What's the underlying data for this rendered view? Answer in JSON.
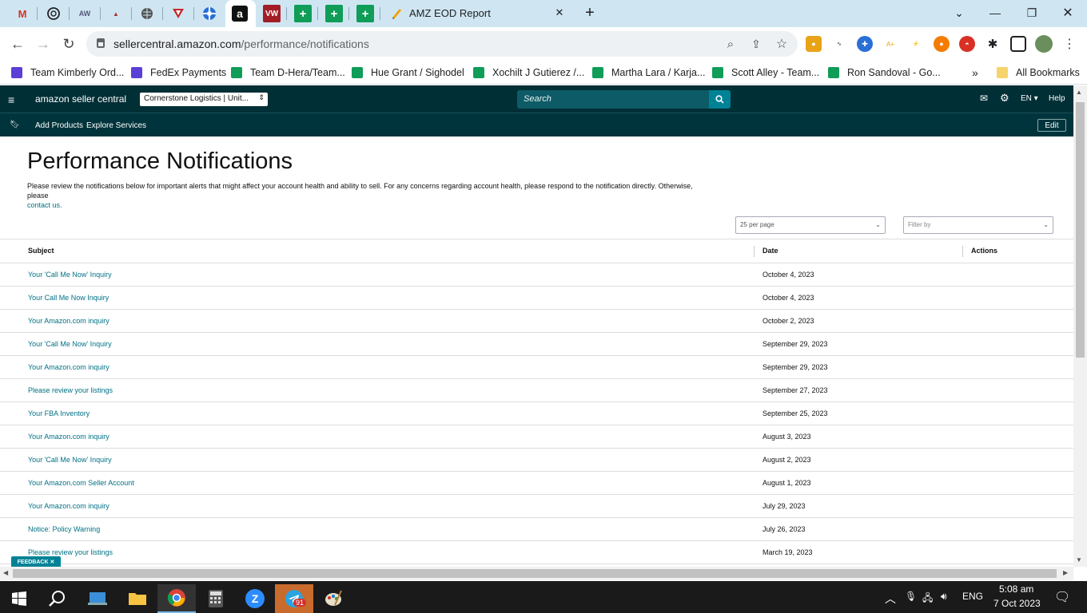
{
  "browser": {
    "active_tab_title": "AMZ EOD Report",
    "url_host": "sellercentral.amazon.com",
    "url_path": "/performance/notifications",
    "bookmarks": [
      {
        "label": "Team Kimberly Ord...",
        "color": "#5b3fd6"
      },
      {
        "label": "FedEx Payments",
        "color": "#5b3fd6"
      },
      {
        "label": "Team D-Hera/Team...",
        "color": "#0f9d58"
      },
      {
        "label": "Hue Grant / Sighodel",
        "color": "#0f9d58"
      },
      {
        "label": "Xochilt J Gutierez /...",
        "color": "#0f9d58"
      },
      {
        "label": "Martha Lara / Karja...",
        "color": "#0f9d58"
      },
      {
        "label": "Scott Alley - Team...",
        "color": "#0f9d58"
      },
      {
        "label": "Ron Sandoval - Go...",
        "color": "#0f9d58"
      }
    ],
    "overflow_label": "»",
    "all_bookmarks_label": "All Bookmarks"
  },
  "seller_central": {
    "logo_text": "amazon seller central",
    "account_selector": "Cornerstone Logistics | Unit...",
    "search_placeholder": "Search",
    "language": "EN",
    "help_label": "Help",
    "nav_links": [
      "Add Products",
      "Explore Services"
    ],
    "edit_label": "Edit"
  },
  "page": {
    "title": "Performance Notifications",
    "description": "Please review the notifications below for important alerts that might affect your account health and ability to sell. For any concerns regarding account health, please respond to the notification directly. Otherwise, please",
    "contact_link": "contact us.",
    "per_page": "25 per page",
    "filter_placeholder": "Filter by"
  },
  "table": {
    "columns": [
      "Subject",
      "Date",
      "Actions"
    ],
    "rows": [
      {
        "subject": "Your 'Call Me Now' Inquiry",
        "date": "October 4, 2023"
      },
      {
        "subject": "Your Call Me Now Inquiry",
        "date": "October 4, 2023"
      },
      {
        "subject": "Your Amazon.com inquiry",
        "date": "October 2, 2023"
      },
      {
        "subject": "Your 'Call Me Now' Inquiry",
        "date": "September 29, 2023"
      },
      {
        "subject": "Your Amazon.com inquiry",
        "date": "September 29, 2023"
      },
      {
        "subject": "Please review your listings",
        "date": "September 27, 2023"
      },
      {
        "subject": "Your FBA Inventory",
        "date": "September 25, 2023"
      },
      {
        "subject": "Your Amazon.com inquiry",
        "date": "August 3, 2023"
      },
      {
        "subject": "Your 'Call Me Now' Inquiry",
        "date": "August 2, 2023"
      },
      {
        "subject": "Your Amazon.com Seller Account",
        "date": "August 1, 2023"
      },
      {
        "subject": "Your Amazon.com inquiry",
        "date": "July 29, 2023"
      },
      {
        "subject": "Notice: Policy Warning",
        "date": "July 26, 2023"
      },
      {
        "subject": "Please review your listings",
        "date": "March 19, 2023"
      }
    ]
  },
  "feedback_label": "FEEDBACK ✕",
  "taskbar": {
    "language": "ENG",
    "time": "5:08 am",
    "date": "7 Oct 2023",
    "telegram_badge": "91"
  },
  "colors": {
    "nav_dark": "#002f36",
    "link": "#007185",
    "accent": "#008296"
  }
}
